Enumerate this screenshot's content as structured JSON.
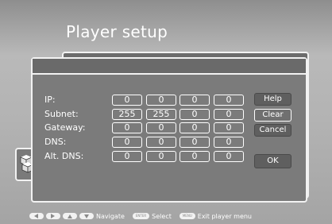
{
  "screen": {
    "title": "Player setup"
  },
  "ip_form": {
    "rows": [
      {
        "label": "IP:",
        "octets": [
          "0",
          "0",
          "0",
          "0"
        ]
      },
      {
        "label": "Subnet:",
        "octets": [
          "255",
          "255",
          "0",
          "0"
        ]
      },
      {
        "label": "Gateway:",
        "octets": [
          "0",
          "0",
          "0",
          "0"
        ]
      },
      {
        "label": "DNS:",
        "octets": [
          "0",
          "0",
          "0",
          "0"
        ]
      },
      {
        "label": "Alt. DNS:",
        "octets": [
          "0",
          "0",
          "0",
          "0"
        ]
      }
    ]
  },
  "buttons": {
    "help": "Help",
    "clear": "Clear",
    "cancel": "Cancel",
    "ok": "OK"
  },
  "footer": {
    "navigate": "Navigate",
    "enter_key": "ENTER",
    "select": "Select",
    "menu_key": "MENU",
    "exit": "Exit player menu"
  },
  "colors": {
    "text": "#ffffff",
    "panel": "#7b7b7b",
    "border": "#f2f2f2",
    "button": "#5f5f5f"
  }
}
